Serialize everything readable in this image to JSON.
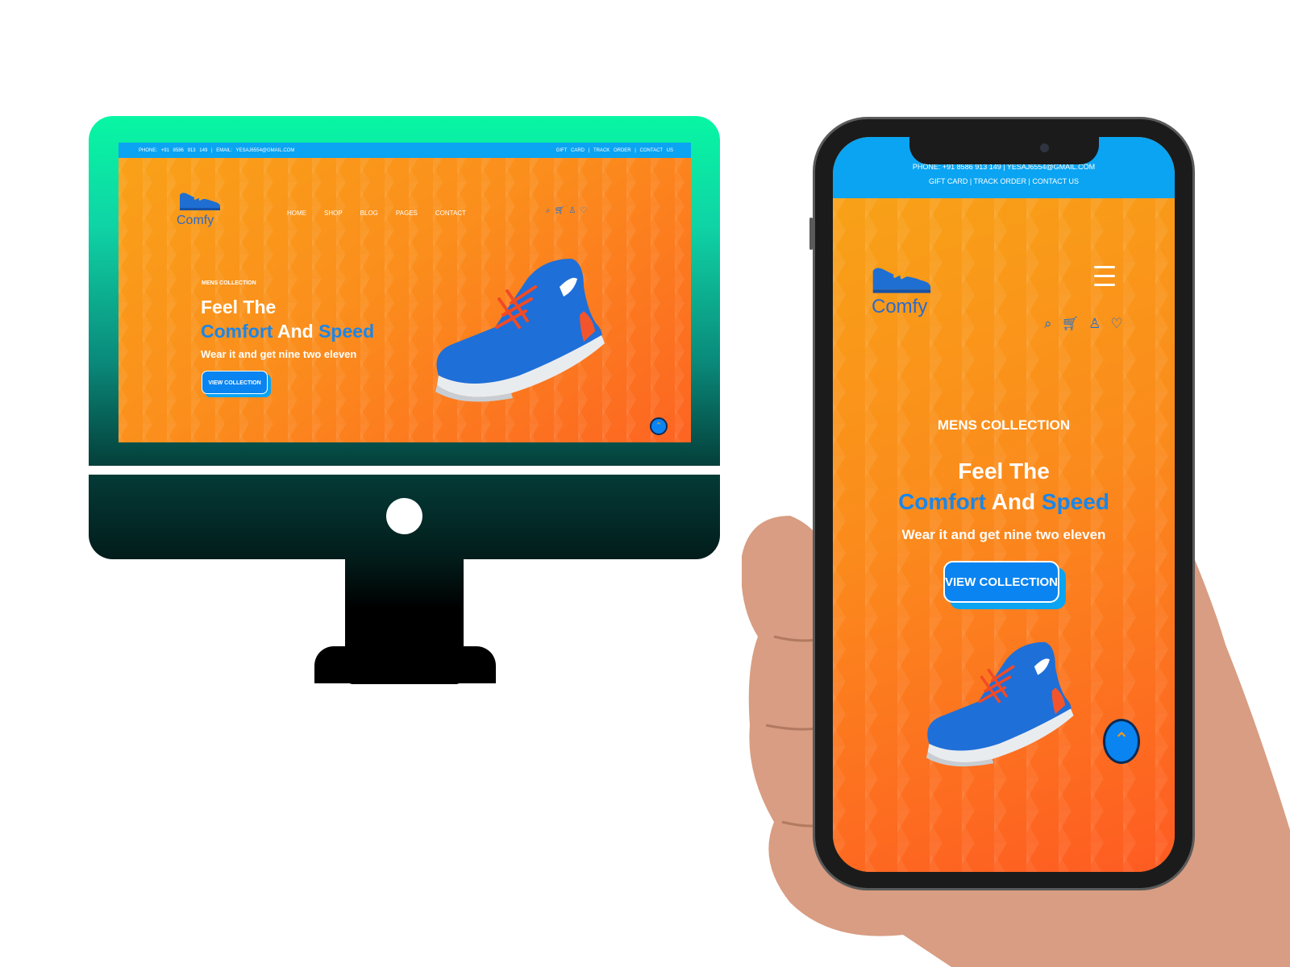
{
  "desktop": {
    "topbar": {
      "left": [
        "PHONE:",
        "+91",
        "8586",
        "913",
        "149",
        "|",
        "EMAIL:",
        "YESAJ6554@GMAIL.COM"
      ],
      "right": [
        "GIFT",
        "CARD",
        "|",
        "TRACK",
        "ORDER",
        "|",
        "CONTACT",
        "US"
      ]
    },
    "logo_text": "Comfy",
    "nav": [
      "HOME",
      "SHOP",
      "BLOG",
      "PAGES",
      "CONTACT"
    ],
    "icons": [
      "search-icon",
      "cart-icon",
      "user-icon",
      "heart-icon"
    ],
    "kicker": "MENS COLLECTION",
    "headline_line1": "Feel The",
    "headline_word_a": "Comfort",
    "headline_word_b": "And",
    "headline_word_c": "Speed",
    "subheadline": "Wear it and get nine two eleven",
    "cta_label": "VIEW COLLECTION",
    "scroll_top_glyph": "⌃"
  },
  "mobile": {
    "topbar_line1": "PHONE: +91 8586 913 149 | YESAJ6554@GMAIL.COM",
    "topbar_line2": "GIFT CARD | TRACK ORDER | CONTACT US",
    "logo_text": "Comfy",
    "icons": [
      "search-icon",
      "cart-icon",
      "user-icon",
      "heart-icon"
    ],
    "kicker": "MENS COLLECTION",
    "headline_line1": "Feel The",
    "headline_word_a": "Comfort",
    "headline_word_b": "And",
    "headline_word_c": "Speed",
    "subheadline": "Wear it and get nine two eleven",
    "cta_label": "VIEW COLLECTION",
    "scroll_top_glyph": "⌃"
  },
  "colors": {
    "accent_blue": "#0a84f0",
    "topbar_blue": "#0aa4f2",
    "hero_orange": "#fb8a1c",
    "monitor_green": "#08f7a4"
  }
}
